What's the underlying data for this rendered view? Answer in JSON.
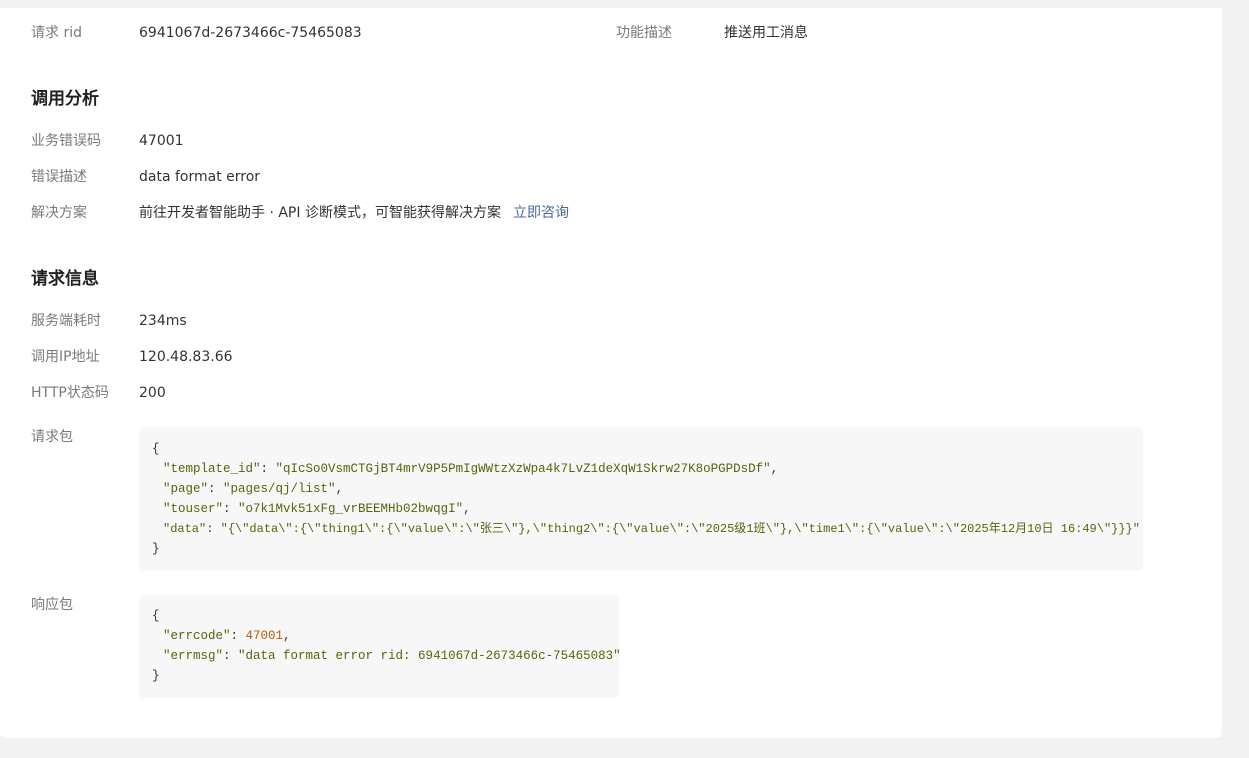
{
  "top": {
    "rid_label": "请求 rid",
    "rid_value": "6941067d-2673466c-75465083",
    "func_label": "功能描述",
    "func_value": "推送用工消息"
  },
  "analysis": {
    "title": "调用分析",
    "errcode_label": "业务错误码",
    "errcode_value": "47001",
    "errdesc_label": "错误描述",
    "errdesc_value": "data format error",
    "solution_label": "解决方案",
    "solution_value": "前往开发者智能助手 · API 诊断模式，可智能获得解决方案",
    "solution_link": "立即咨询"
  },
  "request": {
    "title": "请求信息",
    "server_time_label": "服务端耗时",
    "server_time_value": "234ms",
    "ip_label": "调用IP地址",
    "ip_value": "120.48.83.66",
    "http_label": "HTTP状态码",
    "http_value": "200",
    "req_label": "请求包",
    "req_lines": {
      "open": "{",
      "template_key": "\"template_id\"",
      "template_val": "\"qIcSo0VsmCTGjBT4mrV9P5PmIgWWtzXzWpa4k7LvZ1deXqW1Skrw27K8oPGPDsDf\"",
      "page_key": "\"page\"",
      "page_val": "\"pages/qj/list\"",
      "touser_key": "\"touser\"",
      "touser_val": "\"o7k1Mvk51xFg_vrBEEMHb02bwqgI\"",
      "data_key": "\"data\"",
      "data_val": "\"{\\\"data\\\":{\\\"thing1\\\":{\\\"value\\\":\\\"张三\\\"},\\\"thing2\\\":{\\\"value\\\":\\\"2025级1班\\\"},\\\"time1\\\":{\\\"value\\\":\\\"2025年12月10日 16:49\\\"}}}\"",
      "close": "}"
    },
    "resp_label": "响应包",
    "resp_lines": {
      "open": "{",
      "errcode_key": "\"errcode\"",
      "errcode_val": "47001",
      "errmsg_key": "\"errmsg\"",
      "errmsg_val": "\"data format error rid: 6941067d-2673466c-75465083\"",
      "close": "}"
    }
  }
}
